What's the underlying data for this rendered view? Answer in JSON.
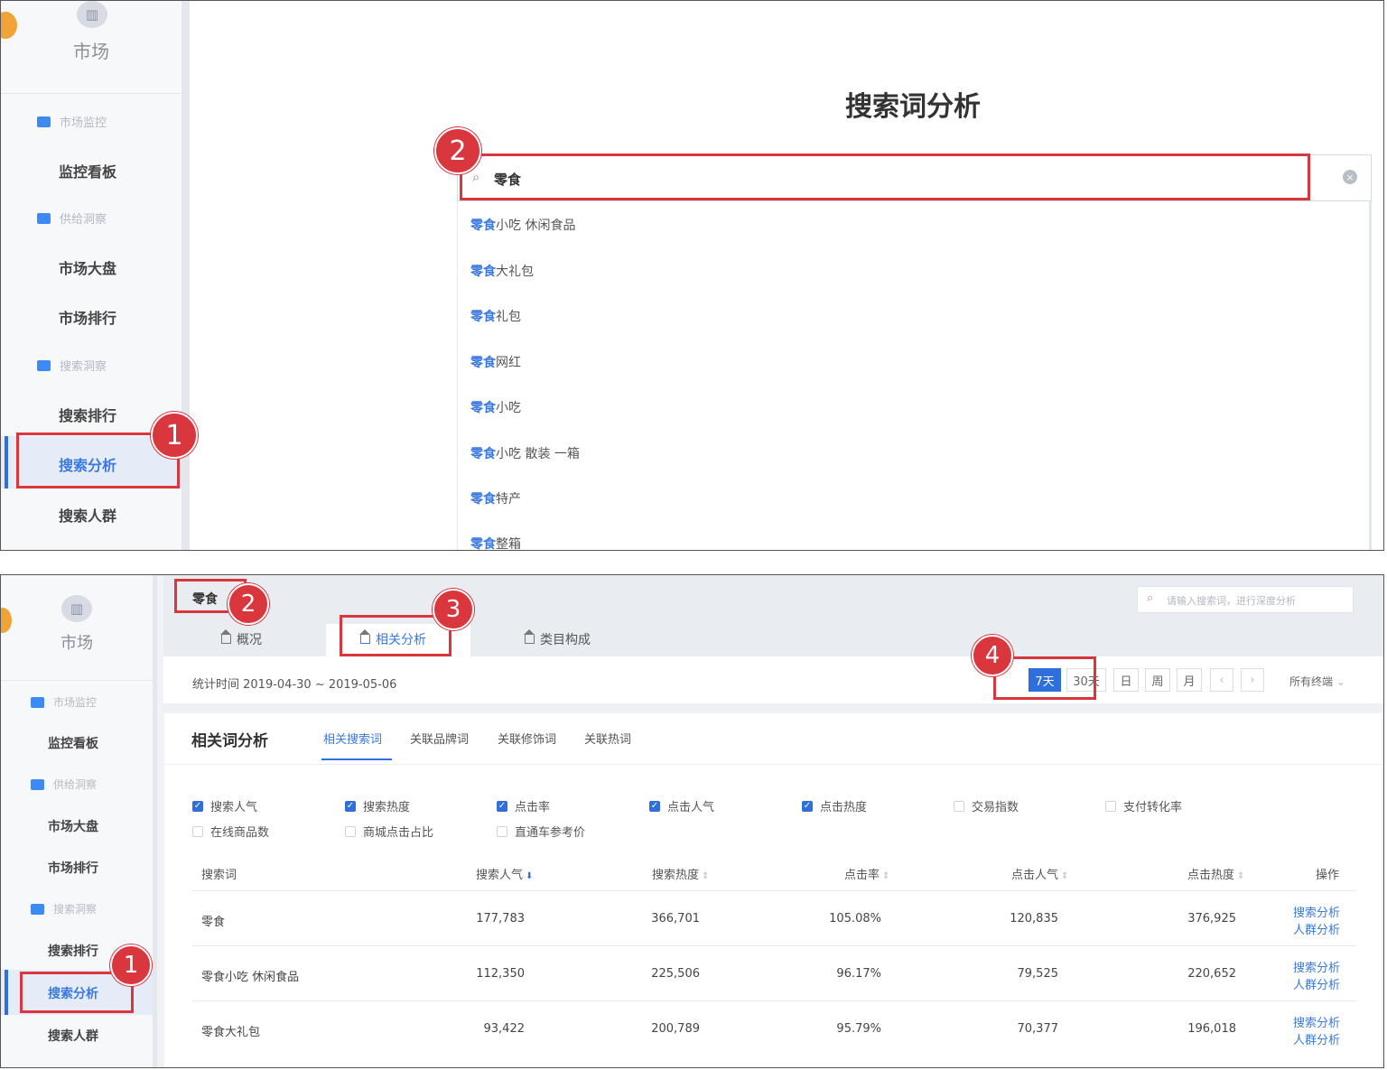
{
  "top": {
    "sidebar": {
      "market_icon": "market-icon",
      "market_label": "市场",
      "groups": [
        "市场监控",
        "供给洞察",
        "搜索洞察"
      ],
      "items": [
        "监控看板",
        "市场大盘",
        "市场排行",
        "搜索排行",
        "搜索分析",
        "搜索人群"
      ],
      "active": "搜索分析"
    },
    "page_title": "搜索词分析",
    "search": {
      "value": "零食"
    },
    "suggestions": [
      {
        "match": "零食",
        "rest": "小吃 休闲食品"
      },
      {
        "match": "零食",
        "rest": "大礼包"
      },
      {
        "match": "零食",
        "rest": "礼包"
      },
      {
        "match": "零食",
        "rest": "网红"
      },
      {
        "match": "零食",
        "rest": "小吃"
      },
      {
        "match": "零食",
        "rest": "小吃 散装 一箱"
      },
      {
        "match": "零食",
        "rest": "特产"
      },
      {
        "match": "零食",
        "rest": "整箱"
      }
    ],
    "annotations": [
      "1",
      "2"
    ]
  },
  "bottom": {
    "sidebar": {
      "market_label": "市场",
      "groups": [
        "市场监控",
        "供给洞察",
        "搜索洞察"
      ],
      "items": [
        "监控看板",
        "市场大盘",
        "市场排行",
        "搜索排行",
        "搜索分析",
        "搜索人群"
      ],
      "active": "搜索分析"
    },
    "keyword": "零食",
    "deep_search_placeholder": "请输入搜索词，进行深度分析",
    "tabs": [
      "概况",
      "相关分析",
      "类目构成"
    ],
    "stat_time": "统计时间 2019-04-30 ~ 2019-05-06",
    "time_buttons": [
      "7天",
      "30天",
      "日",
      "周",
      "月"
    ],
    "terminal_select": "所有终端",
    "section_title": "相关词分析",
    "subtabs": [
      "相关搜索词",
      "关联品牌词",
      "关联修饰词",
      "关联热词"
    ],
    "checkboxes": [
      {
        "label": "搜索人气",
        "checked": true
      },
      {
        "label": "搜索热度",
        "checked": true
      },
      {
        "label": "点击率",
        "checked": true
      },
      {
        "label": "点击人气",
        "checked": true
      },
      {
        "label": "点击热度",
        "checked": true
      },
      {
        "label": "交易指数",
        "checked": false
      },
      {
        "label": "支付转化率",
        "checked": false
      },
      {
        "label": "在线商品数",
        "checked": false
      },
      {
        "label": "商城点击占比",
        "checked": false
      },
      {
        "label": "直通车参考价",
        "checked": false
      }
    ],
    "table": {
      "headers": [
        "搜索词",
        "搜索人气",
        "搜索热度",
        "点击率",
        "点击人气",
        "点击热度",
        "操作"
      ],
      "rows": [
        [
          "零食",
          "177,783",
          "366,701",
          "105.08%",
          "120,835",
          "376,925"
        ],
        [
          "零食小吃 休闲食品",
          "112,350",
          "225,506",
          "96.17%",
          "79,525",
          "220,652"
        ],
        [
          "零食大礼包",
          "93,422",
          "200,789",
          "95.79%",
          "70,377",
          "196,018"
        ]
      ],
      "actions": [
        "搜索分析",
        "人群分析"
      ]
    },
    "annotations": [
      "1",
      "2",
      "3",
      "4"
    ]
  },
  "colors": {
    "accent": "#2f6fdc",
    "annotation_red": "#d9363e",
    "badge_orange": "#f0a437"
  }
}
